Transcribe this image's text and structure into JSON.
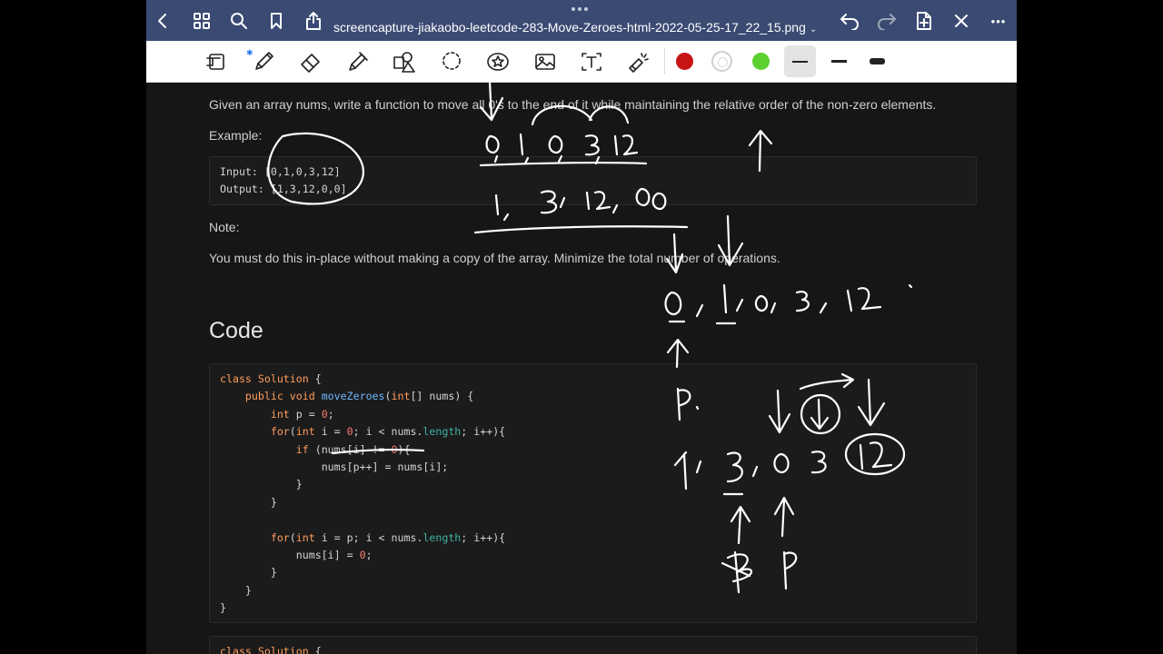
{
  "topbar": {
    "filename": "screencapture-jiakaobo-leetcode-283-Move-Zeroes-html-2022-05-25-17_22_15.png",
    "filename_chevron": "⌄",
    "more_label": "•••"
  },
  "toolbar": {
    "bluetooth_mark": "✱",
    "colors": {
      "red": "#c81414",
      "white": "#ffffff",
      "green": "#5cd02f"
    }
  },
  "doc": {
    "description": "Given an array nums, write a function to move all 0's to the end of it while maintaining the relative order of the non-zero elements.",
    "example_label": "Example:",
    "example_input_label": "Input:",
    "example_input_value": "[0,1,0,3,12]",
    "example_output_label": "Output:",
    "example_output_value": "[1,3,12,0,0]",
    "note_label": "Note:",
    "note_text": "You must do this in-place without making a copy of the array. Minimize the total number of operations.",
    "code_heading": "Code"
  },
  "code": {
    "l1_kw": "class",
    "l1_cls": "Solution",
    "l1_rest": " {",
    "l2_kw": "public",
    "l2_kw2": "void",
    "l2_fn": "moveZeroes",
    "l2_p1": "(",
    "l2_type": "int",
    "l2_rest": "[] nums) {",
    "l3_kw": "int",
    "l3_mid": " p = ",
    "l3_num": "0",
    "l3_end": ";",
    "l4_kw": "for",
    "l4_a": "(",
    "l4_kw2": "int",
    "l4_b": " i = ",
    "l4_num": "0",
    "l4_c": "; i < nums.",
    "l4_prop": "length",
    "l4_d": "; i++){",
    "l5_kw": "if",
    "l5_a": " (nums[i] != ",
    "l5_num": "0",
    "l5_b": "){",
    "l6": "nums[p++] = nums[i];",
    "l7": "}",
    "l8": "}",
    "l9_kw": "for",
    "l9_a": "(",
    "l9_kw2": "int",
    "l9_b": " i = p; i < nums.",
    "l9_prop": "length",
    "l9_c": "; i++){",
    "l10_a": "nums[i] = ",
    "l10_num": "0",
    "l10_b": ";",
    "l11": "}",
    "l12": "}",
    "l13": "}",
    "next_kw": "class",
    "next_cls": "Solution",
    "next_rest": " {"
  }
}
